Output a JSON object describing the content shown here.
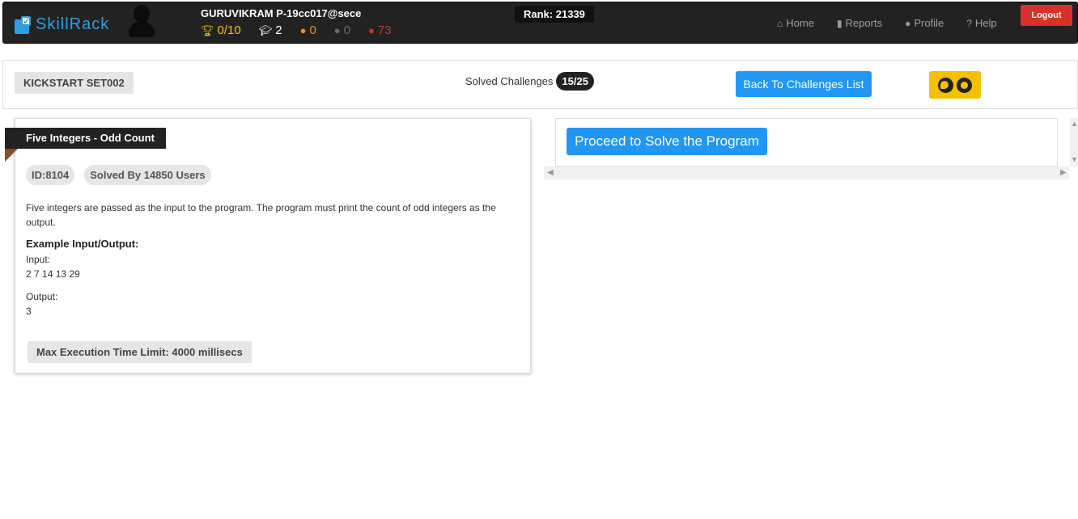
{
  "header": {
    "logo_text": "SkillRack",
    "username": "GURUVIKRAM P-19cc017@sece",
    "rank": "Rank: 21339",
    "stats": [
      {
        "icon": "trophy-icon",
        "value": "0/10",
        "color": "#f2c200"
      },
      {
        "icon": "graduation-cap-icon",
        "value": "2",
        "color": "#ffffff"
      },
      {
        "icon": "gold-medal-icon",
        "value": "0",
        "color": "#f0901c"
      },
      {
        "icon": "silver-medal-icon",
        "value": "0",
        "color": "#6a6a6a"
      },
      {
        "icon": "bronze-medal-icon",
        "value": "73",
        "color": "#c0392b"
      }
    ],
    "nav": {
      "home": "Home",
      "reports": "Reports",
      "profile": "Profile",
      "help": "Help"
    },
    "logout": "Logout"
  },
  "subheader": {
    "set_label": "KICKSTART SET002",
    "solved_label": "Solved Challenges",
    "solved_count": "15/25",
    "back_button": "Back To Challenges List"
  },
  "problem": {
    "title": "Five Integers - Odd Count",
    "id_tag": "ID:8104",
    "solved_by": "Solved By 14850 Users",
    "description": "Five integers are passed as the input to the program. The program must print the count of odd integers as the output.",
    "example_title": "Example Input/Output:",
    "input_label": "Input:",
    "input_value": "2 7 14 13 29",
    "output_label": "Output:",
    "output_value": "3",
    "time_limit": "Max Execution Time Limit: 4000 millisecs"
  },
  "right_panel": {
    "proceed_button": "Proceed to Solve the Program"
  },
  "colors": {
    "navbar": "#222222",
    "primary": "#2196f3",
    "logout": "#d9302a",
    "browser_badge": "#f5c000"
  }
}
